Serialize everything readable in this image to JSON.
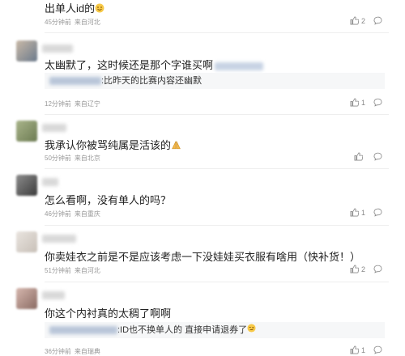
{
  "comments": [
    {
      "text": "出单人id的",
      "time": "45分钟前",
      "location": "来自河北",
      "likes": "2"
    },
    {
      "text": "太幽默了，这时候还是那个字谁买啊",
      "time": "12分钟前",
      "location": "来自辽宁",
      "likes": "1",
      "reply": ":比昨天的比赛内容还幽默"
    },
    {
      "text": "我承认你被骂纯属是活该的",
      "time": "50分钟前",
      "location": "来自北京",
      "likes": ""
    },
    {
      "text": "怎么看啊，没有单人的吗？",
      "time": "46分钟前",
      "location": "来自重庆",
      "likes": "1"
    },
    {
      "text": "你卖娃衣之前是不是应该考虑一下没娃娃买衣服有啥用（快补货！）",
      "time": "51分钟前",
      "location": "来自河北",
      "likes": "2"
    },
    {
      "text": "你这个内衬真的太稠了啊啊",
      "time": "36分钟前",
      "location": "来自瑞典",
      "likes": "1",
      "reply": ":ID也不换单人的 直接申请退券了"
    }
  ],
  "icons": {
    "like": "thumbs-up-icon",
    "reply": "comment-bubble-icon"
  }
}
